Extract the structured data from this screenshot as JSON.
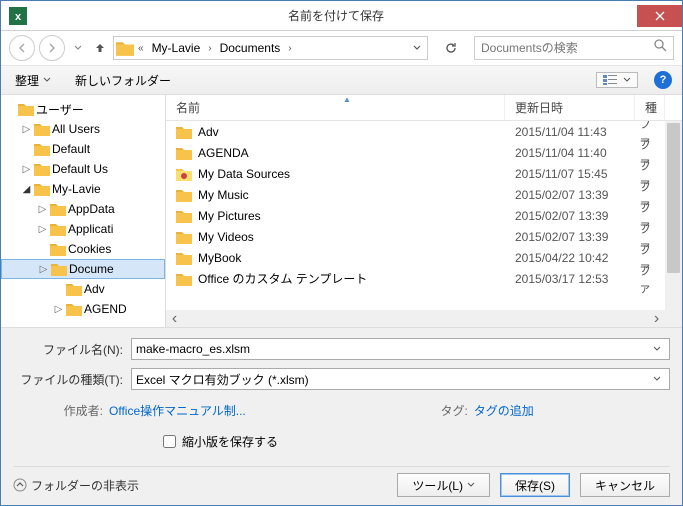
{
  "title": "名前を付けて保存",
  "breadcrumb": {
    "segments": [
      "My-Lavie",
      "Documents"
    ]
  },
  "search": {
    "placeholder": "Documentsの検索"
  },
  "toolbar": {
    "organize": "整理",
    "newfolder": "新しいフォルダー"
  },
  "tree": [
    {
      "depth": 1,
      "label": "ユーザー",
      "open": true
    },
    {
      "depth": 2,
      "label": "All Users",
      "open": false,
      "tw": true
    },
    {
      "depth": 2,
      "label": "Default",
      "open": false
    },
    {
      "depth": 2,
      "label": "Default Us",
      "open": false,
      "tw": true
    },
    {
      "depth": 2,
      "label": "My-Lavie",
      "open": true,
      "tw": true
    },
    {
      "depth": 3,
      "label": "AppData",
      "tw": true
    },
    {
      "depth": 3,
      "label": "Applicati",
      "tw": true
    },
    {
      "depth": 3,
      "label": "Cookies"
    },
    {
      "depth": 3,
      "label": "Docume",
      "sel": true,
      "tw": true
    },
    {
      "depth": 4,
      "label": "Adv"
    },
    {
      "depth": 4,
      "label": "AGEND",
      "tw": true
    }
  ],
  "columns": {
    "name": "名前",
    "date": "更新日時",
    "type": "種"
  },
  "files": [
    {
      "name": "Adv",
      "date": "2015/11/04 11:43",
      "type": "ファ",
      "icon": "folder"
    },
    {
      "name": "AGENDA",
      "date": "2015/11/04 11:40",
      "type": "ファ",
      "icon": "folder"
    },
    {
      "name": "My Data Sources",
      "date": "2015/11/07 15:45",
      "type": "ファ",
      "icon": "datasource"
    },
    {
      "name": "My Music",
      "date": "2015/02/07 13:39",
      "type": "ファ",
      "icon": "folder"
    },
    {
      "name": "My Pictures",
      "date": "2015/02/07 13:39",
      "type": "ファ",
      "icon": "folder"
    },
    {
      "name": "My Videos",
      "date": "2015/02/07 13:39",
      "type": "ファ",
      "icon": "folder"
    },
    {
      "name": "MyBook",
      "date": "2015/04/22 10:42",
      "type": "ファ",
      "icon": "folder"
    },
    {
      "name": "Office のカスタム テンプレート",
      "date": "2015/03/17 12:53",
      "type": "ファ",
      "icon": "folder"
    }
  ],
  "filename": {
    "label": "ファイル名(N):",
    "value": "make-macro_es.xlsm"
  },
  "filetype": {
    "label": "ファイルの種類(T):",
    "value": "Excel マクロ有効ブック (*.xlsm)"
  },
  "meta": {
    "author_label": "作成者:",
    "author": "Office操作マニュアル制...",
    "tag_label": "タグ:",
    "tag": "タグの追加"
  },
  "thumbnail": "縮小版を保存する",
  "footer": {
    "hide": "フォルダーの非表示",
    "tool": "ツール(L)",
    "save": "保存(S)",
    "cancel": "キャンセル"
  }
}
